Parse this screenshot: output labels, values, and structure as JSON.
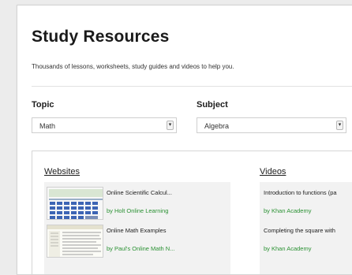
{
  "header": {
    "title": "Study Resources",
    "subtitle": "Thousands of lessons, worksheets, study guides and videos to help you."
  },
  "filters": {
    "topic": {
      "label": "Topic",
      "value": "Math",
      "icon": "chevron-down-icon"
    },
    "subject": {
      "label": "Subject",
      "value": "Algebra",
      "icon": "chevron-down-icon"
    }
  },
  "websites": {
    "heading": "Websites",
    "items": [
      {
        "title": "Online Scientific Calcul...",
        "by": "by Holt Online Learning",
        "thumb": "calculator-thumbnail"
      },
      {
        "title": "Online Math Examples",
        "by": "by Paul's Online Math N...",
        "thumb": "document-thumbnail"
      }
    ]
  },
  "videos": {
    "heading": "Videos",
    "items": [
      {
        "title": "Introduction to functions (pa",
        "by": "by Khan Academy"
      },
      {
        "title": "Completing the square with",
        "by": "by Khan Academy"
      }
    ]
  },
  "colors": {
    "link_green": "#2a9133",
    "panel_bg": "#f2f2f2",
    "page_bg": "#ececec"
  }
}
